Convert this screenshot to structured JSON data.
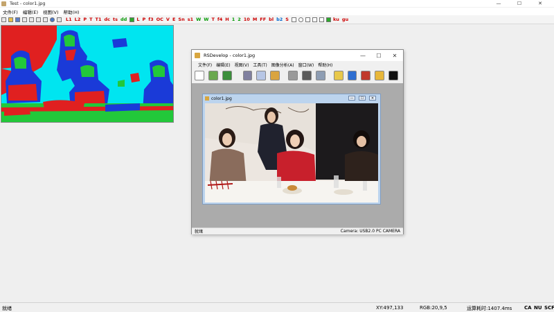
{
  "window": {
    "title": "Test - color1.jpg",
    "minimize": "—",
    "maximize": "☐",
    "close": "✕"
  },
  "menubar": [
    {
      "label": "文件(F)"
    },
    {
      "label": "编辑(E)"
    },
    {
      "label": "视图(V)"
    },
    {
      "label": "帮助(H)"
    }
  ],
  "toolbar": {
    "buttons": [
      "L1",
      "L2",
      "P",
      "T",
      "T1",
      "dc",
      "ts",
      "dd",
      "L",
      "P",
      "f3",
      "OC",
      "V",
      "E",
      "Sn",
      "s1",
      "W",
      "W",
      "T",
      "f4",
      "H",
      "1",
      "2",
      "10",
      "M",
      "FF",
      "bl",
      "b2",
      "S",
      "ku",
      "gu"
    ]
  },
  "child_window": {
    "title": "RSDevelop - color1.jpg",
    "menu": [
      {
        "label": "文件(F)"
      },
      {
        "label": "编辑(E)"
      },
      {
        "label": "视图(V)"
      },
      {
        "label": "工具(T)"
      },
      {
        "label": "图像分析(A)"
      },
      {
        "label": "窗口(W)"
      },
      {
        "label": "帮助(H)"
      }
    ],
    "tools": [
      {
        "icon": "new-icon",
        "color": "#ffffff"
      },
      {
        "icon": "open-icon",
        "color": "#6aa84f"
      },
      {
        "icon": "save-icon",
        "color": "#3c8f3c"
      },
      {
        "icon": "cut-icon",
        "color": "#7f7f9f"
      },
      {
        "icon": "copy-icon",
        "color": "#b7c6e5"
      },
      {
        "icon": "paste-icon",
        "color": "#d9a441"
      },
      {
        "icon": "camera-icon",
        "color": "#9a9a9a"
      },
      {
        "icon": "capture-icon",
        "color": "#5b5b5b"
      },
      {
        "icon": "cube-icon",
        "color": "#8e9db3"
      },
      {
        "icon": "highlight-icon",
        "color": "#e8c84a"
      },
      {
        "icon": "zoom-icon",
        "color": "#2f6fd1"
      },
      {
        "icon": "select-icon",
        "color": "#c0392b"
      },
      {
        "icon": "crop-icon",
        "color": "#e8b73a"
      },
      {
        "icon": "splat-icon",
        "color": "#111111"
      }
    ],
    "status_left": "就绪",
    "status_right": "Camera: USB2.0 PC CAMERA",
    "image_window": {
      "title": "color1.jpg"
    }
  },
  "statusbar": {
    "ready": "就绪",
    "xy": "XY:497,133",
    "rgb": "RGB:20,9,5",
    "timing": "运算耗时:1407.4ms",
    "caps": "CA",
    "num": "NU",
    "scroll": "SCF"
  },
  "colors": {
    "processed_cyan": "#00e5f0",
    "processed_red": "#e02020",
    "processed_green": "#22c83a",
    "processed_blue": "#1a3ad8"
  }
}
